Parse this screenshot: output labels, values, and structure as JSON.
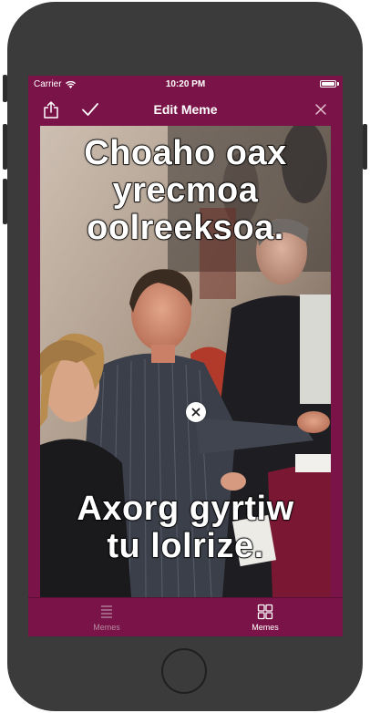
{
  "status_bar": {
    "carrier": "Carrier",
    "time": "10:20 PM",
    "wifi_icon": "wifi-icon",
    "battery_icon": "battery-icon"
  },
  "nav_bar": {
    "title": "Edit Meme",
    "share_icon": "share-icon",
    "done_icon": "checkmark-icon",
    "close_icon": "close-icon"
  },
  "meme": {
    "top_text": "Choaho oax\nyrecmoa\noolreeksoa.",
    "bottom_text": "Axorg gyrtiw\ntu lolrize.",
    "remove_icon": "remove-circle-icon"
  },
  "tab_bar": {
    "tabs": [
      {
        "label": "Memes",
        "icon": "list-icon",
        "active": false
      },
      {
        "label": "Memes",
        "icon": "grid-icon",
        "active": true
      }
    ]
  },
  "colors": {
    "brand": "#7a1448",
    "tab_inactive": "#b58aa0",
    "tab_active": "#ffffff",
    "device_frame": "#3b3b3b"
  }
}
